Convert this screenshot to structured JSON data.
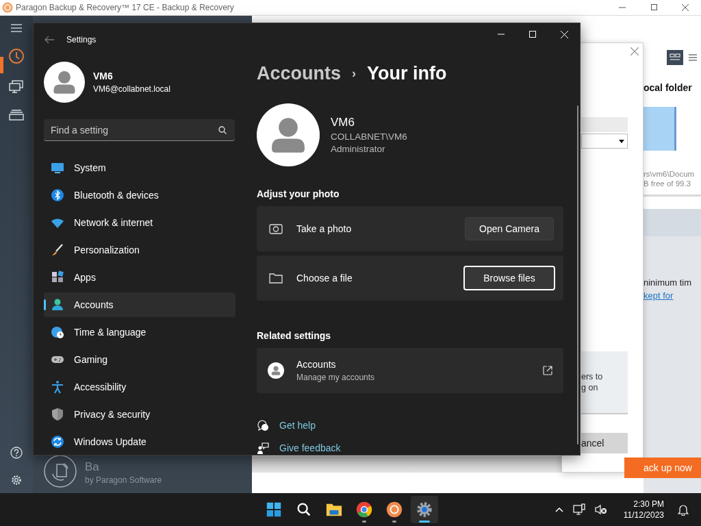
{
  "background_app": {
    "title": "Paragon Backup & Recovery™ 17 CE - Backup & Recovery",
    "product_name": "Ba",
    "vendor": "by Paragon Software",
    "destination_title": "ocal folder",
    "path": "rs\\vm6\\Docum",
    "free_space": "B free of 99.3",
    "retention_text": "ninimum tim",
    "retention_link": "kept for",
    "backup_button": "ack up now"
  },
  "dialog": {
    "note_lines": [
      "ers to",
      "g on"
    ],
    "cancel_button": "ancel"
  },
  "settings": {
    "title": "Settings",
    "user": {
      "name": "VM6",
      "email": "VM6@collabnet.local"
    },
    "search": {
      "placeholder": "Find a setting"
    },
    "nav": [
      {
        "label": "System",
        "selected": false
      },
      {
        "label": "Bluetooth & devices",
        "selected": false
      },
      {
        "label": "Network & internet",
        "selected": false
      },
      {
        "label": "Personalization",
        "selected": false
      },
      {
        "label": "Apps",
        "selected": false
      },
      {
        "label": "Accounts",
        "selected": true
      },
      {
        "label": "Time & language",
        "selected": false
      },
      {
        "label": "Gaming",
        "selected": false
      },
      {
        "label": "Accessibility",
        "selected": false
      },
      {
        "label": "Privacy & security",
        "selected": false
      },
      {
        "label": "Windows Update",
        "selected": false
      }
    ],
    "breadcrumb": {
      "parent": "Accounts",
      "separator": "›",
      "current": "Your info"
    },
    "profile": {
      "name": "VM6",
      "account": "COLLABNET\\VM6",
      "role": "Administrator"
    },
    "photo_section": {
      "heading": "Adjust your photo",
      "rows": [
        {
          "label": "Take a photo",
          "button": "Open Camera",
          "focused": false
        },
        {
          "label": "Choose a file",
          "button": "Browse files",
          "focused": true
        }
      ]
    },
    "related": {
      "heading": "Related settings",
      "items": [
        {
          "title": "Accounts",
          "subtitle": "Manage my accounts"
        }
      ]
    },
    "help_links": [
      "Get help",
      "Give feedback"
    ]
  },
  "taskbar": {
    "apps": [
      {
        "running": false,
        "selected": false
      },
      {
        "running": false,
        "selected": false
      },
      {
        "running": false,
        "selected": false
      },
      {
        "running": true,
        "selected": false
      },
      {
        "running": true,
        "selected": false
      },
      {
        "running": true,
        "selected": true
      }
    ],
    "time": "2:30 PM",
    "date": "11/12/2023"
  }
}
